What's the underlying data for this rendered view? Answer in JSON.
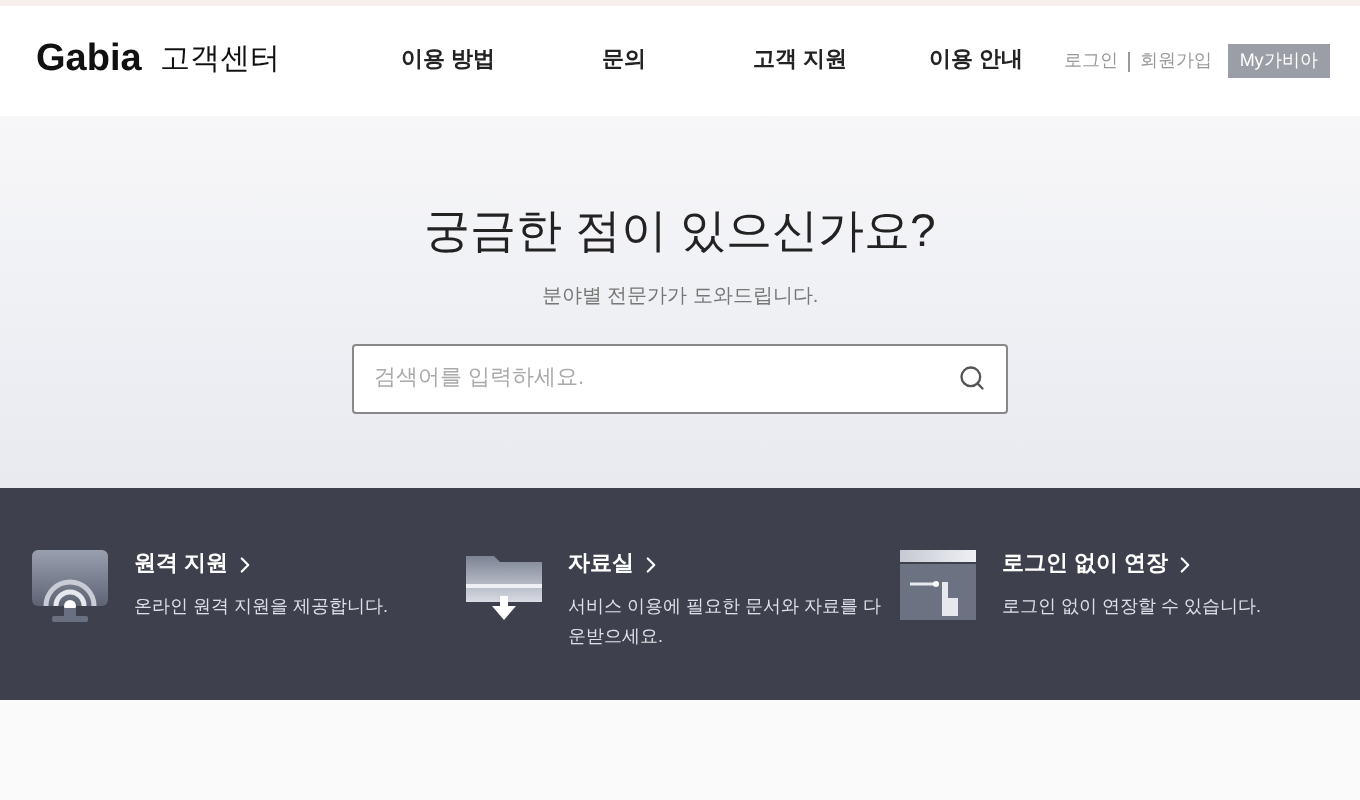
{
  "header": {
    "logo": "Gabia",
    "site_title": "고객센터",
    "nav": [
      "이용 방법",
      "문의",
      "고객 지원",
      "이용 안내"
    ],
    "login": "로그인",
    "signup": "회원가입",
    "my_button": "My가비아"
  },
  "hero": {
    "title": "궁금한 점이 있으신가요?",
    "subtitle": "분야별 전문가가 도와드립니다.",
    "search": {
      "placeholder": "검색어를 입력하세요."
    }
  },
  "features": [
    {
      "kind": "monitor",
      "title": "원격 지원",
      "description": "온라인 원격 지원을 제공합니다."
    },
    {
      "kind": "folder",
      "title": "자료실",
      "description": "서비스 이용에 필요한 문서와 자료를 다운받으세요."
    },
    {
      "kind": "window",
      "title": "로그인 없이 연장",
      "description": "로그인 없이 연장할 수 있습니다."
    }
  ]
}
